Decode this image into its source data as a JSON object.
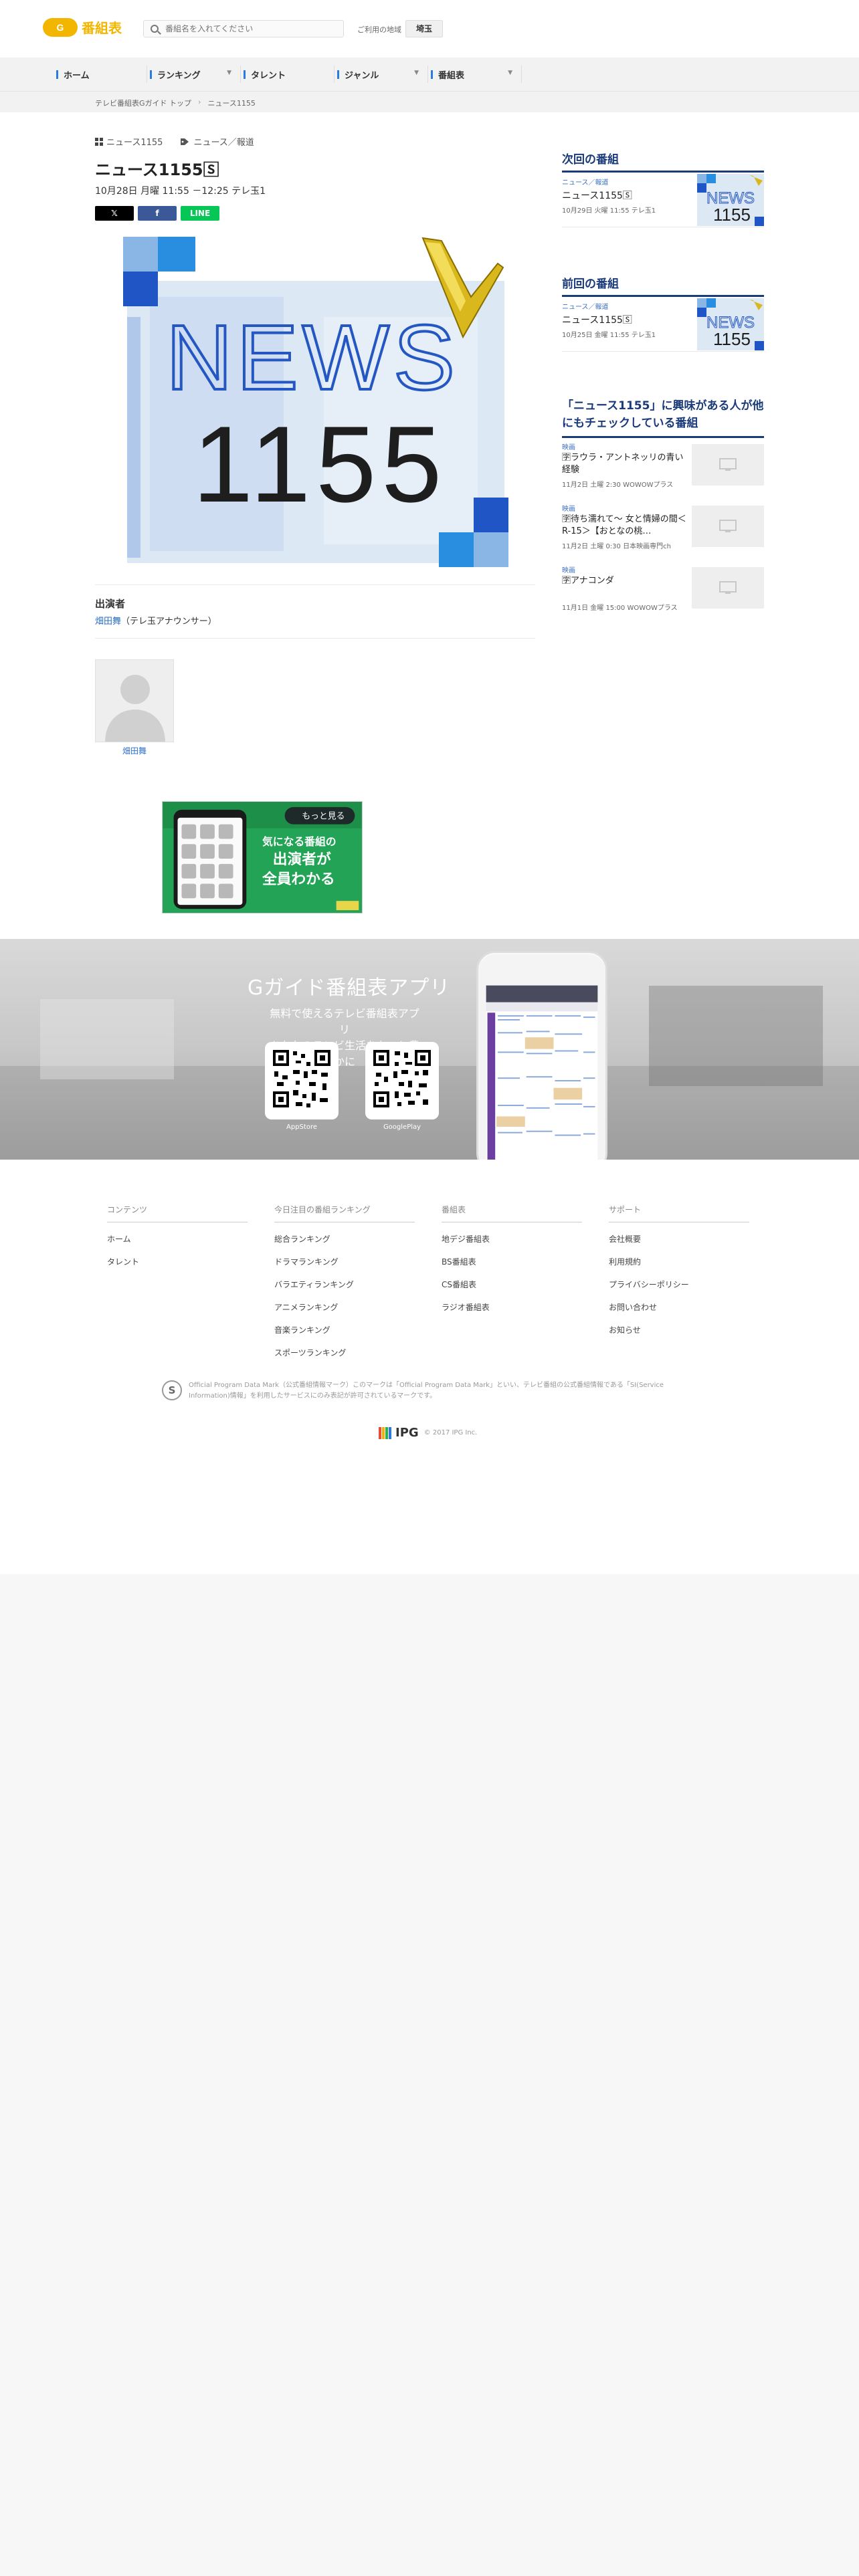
{
  "header": {
    "logo_mark": "G",
    "logo_text": "番組表",
    "search_placeholder": "番組名を入れてください",
    "region_label": "ご利用の地域",
    "region_value": "埼玉"
  },
  "nav": {
    "items": [
      {
        "label": "ホーム",
        "has_dropdown": false
      },
      {
        "label": "ランキング",
        "has_dropdown": true
      },
      {
        "label": "タレント",
        "has_dropdown": false
      },
      {
        "label": "ジャンル",
        "has_dropdown": true
      },
      {
        "label": "番組表",
        "has_dropdown": true
      }
    ]
  },
  "breadcrumb": [
    "テレビ番組表Gガイド トップ",
    "ニュース1155"
  ],
  "program": {
    "series": "ニュース1155",
    "category": "ニュース／報道",
    "title": "ニュース1155🅂",
    "time": "10月28日 月曜 11:55 －12:25 テレ玉1",
    "share": {
      "x": "𝕏",
      "facebook": "f",
      "line": "LINE"
    }
  },
  "hero_logo": {
    "line1": "NEWS",
    "line2": "1155"
  },
  "performers": {
    "label": "出演者",
    "name": "畑田舞",
    "role": "（テレ玉アナウンサー）",
    "avatar_name": "畑田舞"
  },
  "ad": {
    "more": "もっと見る",
    "line1": "気になる番組の",
    "line2": "出演者が",
    "line3": "全員わかる"
  },
  "sidebar": {
    "next": {
      "heading": "次回の番組",
      "category": "ニュース／報道",
      "name": "ニュース1155🅂",
      "when": "10月29日 火曜 11:55 テレ玉1"
    },
    "prev": {
      "heading": "前回の番組",
      "category": "ニュース／報道",
      "name": "ニュース1155🅂",
      "when": "10月25日 金曜 11:55 テレ玉1"
    },
    "related": {
      "heading": "「ニュース1155」に興味がある人が他にもチェックしている番組",
      "items": [
        {
          "category": "映画",
          "name": "🈑ラウラ・アントネッリの青い経験",
          "when": "11月2日 土曜 2:30 WOWOWプラス"
        },
        {
          "category": "映画",
          "name": "🈑待ち濡れて～ 女と情婦の間＜R-15＞【おとなの桃…",
          "when": "11月2日 土曜 0:30 日本映画専門ch"
        },
        {
          "category": "映画",
          "name": "🈑アナコンダ",
          "when": "11月1日 金曜 15:00 WOWOWプラス"
        }
      ]
    }
  },
  "promo": {
    "title": "Gガイド番組表アプリ",
    "sub1": "無料で使えるテレビ番組表アプリ",
    "sub2": "あなたのテレビ生活をもっと豊かに",
    "appstore": "AppStore",
    "googleplay": "GooglePlay"
  },
  "footer": {
    "cols": [
      {
        "heading": "コンテンツ",
        "links": [
          "ホーム",
          "タレント"
        ]
      },
      {
        "heading": "今日注目の番組ランキング",
        "links": [
          "総合ランキング",
          "ドラマランキング",
          "バラエティランキング",
          "アニメランキング",
          "音楽ランキング",
          "スポーツランキング"
        ]
      },
      {
        "heading": "番組表",
        "links": [
          "地デジ番組表",
          "BS番組表",
          "CS番組表",
          "ラジオ番組表"
        ]
      },
      {
        "heading": "サポート",
        "links": [
          "会社概要",
          "利用規約",
          "プライバシーポリシー",
          "お問い合わせ",
          "お知らせ"
        ]
      }
    ],
    "opd_mark": "S",
    "opd_text": "Official Program Data Mark（公式番組情報マーク）このマークは「Official Program Data Mark」といい、テレビ番組の公式番組情報である「SI(Service Information)情報」を利用したサービスにのみ表記が許可されているマークです。",
    "ipg_text": "IPG",
    "copyright": "© 2017 IPG Inc."
  }
}
